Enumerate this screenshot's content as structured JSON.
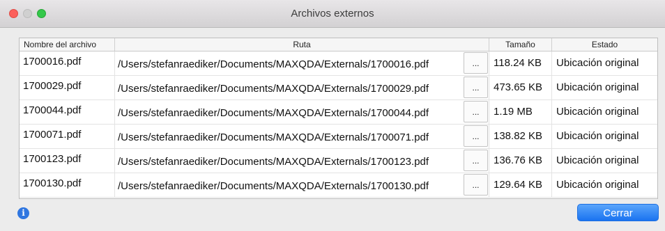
{
  "window": {
    "title": "Archivos externos"
  },
  "table": {
    "headers": [
      "Nombre del archivo",
      "Ruta",
      "Tamaño",
      "Estado"
    ],
    "browse_label": "...",
    "rows": [
      {
        "name": "1700016.pdf",
        "path": "/Users/stefanraediker/Documents/MAXQDA/Externals/1700016.pdf",
        "size": "118.24 KB",
        "status": "Ubicación original"
      },
      {
        "name": "1700029.pdf",
        "path": "/Users/stefanraediker/Documents/MAXQDA/Externals/1700029.pdf",
        "size": "473.65 KB",
        "status": "Ubicación original"
      },
      {
        "name": "1700044.pdf",
        "path": "/Users/stefanraediker/Documents/MAXQDA/Externals/1700044.pdf",
        "size": "1.19 MB",
        "status": "Ubicación original"
      },
      {
        "name": "1700071.pdf",
        "path": "/Users/stefanraediker/Documents/MAXQDA/Externals/1700071.pdf",
        "size": "138.82 KB",
        "status": "Ubicación original"
      },
      {
        "name": "1700123.pdf",
        "path": "/Users/stefanraediker/Documents/MAXQDA/Externals/1700123.pdf",
        "size": "136.76 KB",
        "status": "Ubicación original"
      },
      {
        "name": "1700130.pdf",
        "path": "/Users/stefanraediker/Documents/MAXQDA/Externals/1700130.pdf",
        "size": "129.64 KB",
        "status": "Ubicación original"
      }
    ]
  },
  "footer": {
    "info_icon": "info-icon",
    "close_label": "Cerrar"
  },
  "colors": {
    "accent": "#1a73f0",
    "close": "#fc605c",
    "zoom": "#34c84a"
  }
}
